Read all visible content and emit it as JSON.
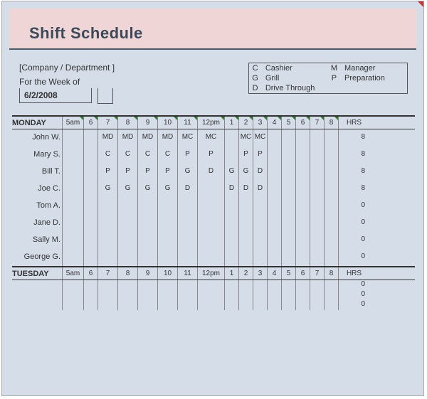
{
  "title": "Shift Schedule",
  "company_placeholder": "[Company / Department ]",
  "week_label": "For the Week of",
  "week_date": "6/2/2008",
  "legend": [
    {
      "code": "C",
      "label": "Cashier"
    },
    {
      "code": "M",
      "label": "Manager"
    },
    {
      "code": "G",
      "label": "Grill"
    },
    {
      "code": "P",
      "label": "Preparation"
    },
    {
      "code": "D",
      "label": "Drive Through"
    }
  ],
  "hour_headers": [
    "5am",
    "6",
    "7",
    "8",
    "9",
    "10",
    "11",
    "12pm",
    "1",
    "2",
    "3",
    "4",
    "5",
    "6",
    "7",
    "8"
  ],
  "hrs_label": "HRS",
  "days": [
    {
      "name": "MONDAY",
      "employees": [
        {
          "name": "John W.",
          "cells": [
            "",
            "",
            "MD",
            "MD",
            "MD",
            "MD",
            "MC",
            "MC",
            "",
            "MC",
            "MC",
            "",
            "",
            "",
            "",
            ""
          ],
          "hrs": "8"
        },
        {
          "name": "Mary S.",
          "cells": [
            "",
            "",
            "C",
            "C",
            "C",
            "C",
            "P",
            "P",
            "",
            "P",
            "P",
            "",
            "",
            "",
            "",
            ""
          ],
          "hrs": "8"
        },
        {
          "name": "Bill T.",
          "cells": [
            "",
            "",
            "P",
            "P",
            "P",
            "P",
            "G",
            "D",
            "G",
            "G",
            "D",
            "",
            "",
            "",
            "",
            ""
          ],
          "hrs": "8"
        },
        {
          "name": "Joe C.",
          "cells": [
            "",
            "",
            "G",
            "G",
            "G",
            "G",
            "D",
            "",
            "D",
            "D",
            "D",
            "",
            "",
            "",
            "",
            ""
          ],
          "hrs": "8"
        },
        {
          "name": "Tom A.",
          "cells": [
            "",
            "",
            "",
            "",
            "",
            "",
            "",
            "",
            "",
            "",
            "",
            "",
            "",
            "",
            "",
            ""
          ],
          "hrs": "0"
        },
        {
          "name": "Jane D.",
          "cells": [
            "",
            "",
            "",
            "",
            "",
            "",
            "",
            "",
            "",
            "",
            "",
            "",
            "",
            "",
            "",
            ""
          ],
          "hrs": "0"
        },
        {
          "name": "Sally M.",
          "cells": [
            "",
            "",
            "",
            "",
            "",
            "",
            "",
            "",
            "",
            "",
            "",
            "",
            "",
            "",
            "",
            ""
          ],
          "hrs": "0"
        },
        {
          "name": "George G.",
          "cells": [
            "",
            "",
            "",
            "",
            "",
            "",
            "",
            "",
            "",
            "",
            "",
            "",
            "",
            "",
            "",
            ""
          ],
          "hrs": "0"
        }
      ]
    },
    {
      "name": "TUESDAY",
      "employees": [
        {
          "name": "",
          "cells": [
            "",
            "",
            "",
            "",
            "",
            "",
            "",
            "",
            "",
            "",
            "",
            "",
            "",
            "",
            "",
            ""
          ],
          "hrs": "0"
        },
        {
          "name": "",
          "cells": [
            "",
            "",
            "",
            "",
            "",
            "",
            "",
            "",
            "",
            "",
            "",
            "",
            "",
            "",
            "",
            ""
          ],
          "hrs": "0"
        },
        {
          "name": "",
          "cells": [
            "",
            "",
            "",
            "",
            "",
            "",
            "",
            "",
            "",
            "",
            "",
            "",
            "",
            "",
            "",
            ""
          ],
          "hrs": "0"
        }
      ]
    }
  ]
}
